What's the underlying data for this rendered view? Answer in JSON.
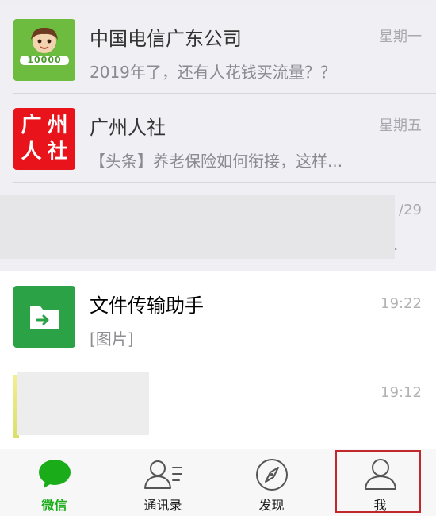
{
  "chats": [
    {
      "title": "中国电信广东公司",
      "preview": "2019年了，还有人花钱买流量？？",
      "time": "星期一",
      "avatar_text": "10000"
    },
    {
      "title": "广州人社",
      "preview": "【头条】养老保险如何衔接，这样...",
      "time": "星期五",
      "avatar_text": [
        "广",
        "州",
        "人",
        "社"
      ]
    },
    {
      "title": "",
      "preview": ".",
      "time": "/29"
    },
    {
      "title": "文件传输助手",
      "preview": "[图片]",
      "time": "19:22"
    },
    {
      "title": "",
      "preview": "",
      "time": "19:12"
    }
  ],
  "tabbar": {
    "tabs": [
      {
        "label": "微信",
        "icon": "chat-bubble-icon",
        "active": true
      },
      {
        "label": "通讯录",
        "icon": "contacts-icon",
        "active": false
      },
      {
        "label": "发现",
        "icon": "compass-icon",
        "active": false
      },
      {
        "label": "我",
        "icon": "person-icon",
        "active": false
      }
    ]
  },
  "colors": {
    "wechat_green": "#1aad19",
    "telecom_avatar": "#6dbb3f",
    "renshe_avatar": "#e8131b",
    "file_helper_avatar": "#2ba245",
    "highlight_border": "#c0282c"
  }
}
